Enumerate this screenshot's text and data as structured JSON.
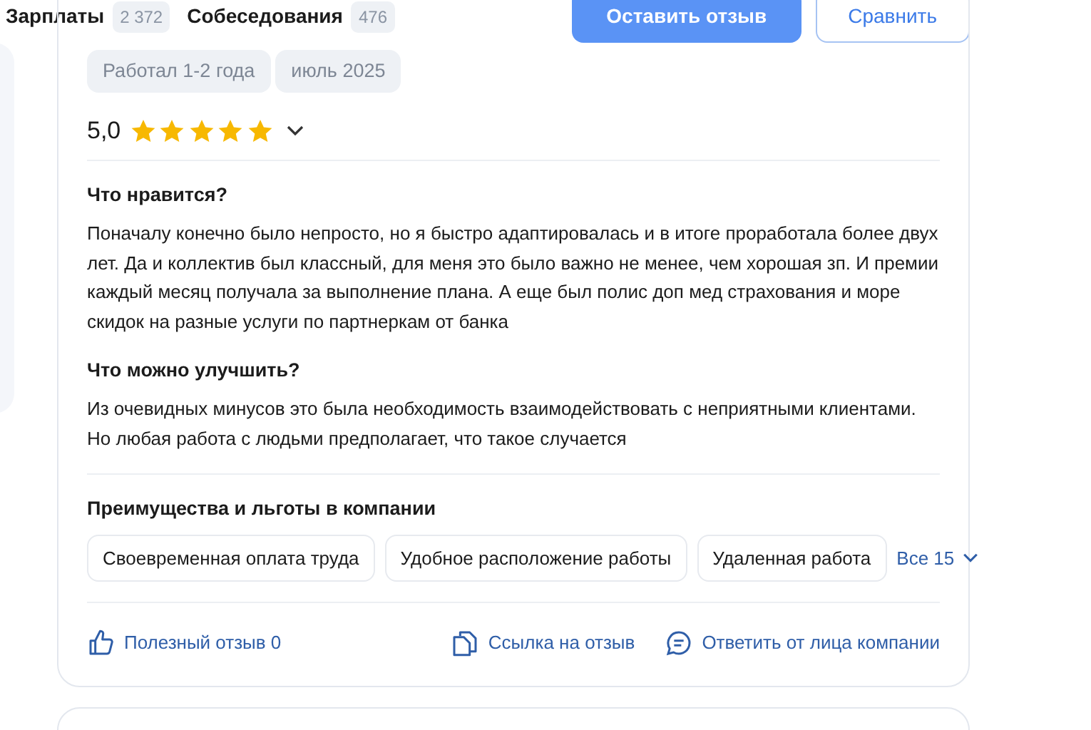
{
  "top_bar": {
    "tabs": [
      {
        "label": "Зарплаты",
        "count": "2 372"
      },
      {
        "label": "Собеседования",
        "count": "476"
      }
    ],
    "buttons": [
      {
        "label": "Оставить отзыв",
        "kind": "primary"
      },
      {
        "label": "Сравнить",
        "kind": "outline"
      }
    ]
  },
  "review": {
    "tags": [
      "Работал 1-2 года",
      "июль 2025"
    ],
    "rating": "5,0",
    "stars": 5,
    "sections": [
      {
        "title": "Что нравится?",
        "text": "Поначалу конечно было непросто, но я быстро адаптировалась и в итоге проработала более двух лет. Да и коллектив был классный, для меня это было важно не менее, чем хорошая зп. И премии каждый месяц получала за выполнение плана. А еще был полис доп мед страхования и море скидок на разные услуги по партнеркам от банка"
      },
      {
        "title": "Что можно улучшить?",
        "text": "Из очевидных минусов это была необходимость взаимодействовать с неприятными клиентами. Но любая работа с людьми предполагает, что такое случается"
      }
    ],
    "benefits": {
      "title": "Преимущества и льготы в компании",
      "items": [
        "Своевременная оплата труда",
        "Удобное расположение работы",
        "Удаленная работа"
      ],
      "more": "Все 15"
    },
    "actions": [
      {
        "label": "Полезный отзыв 0",
        "kind": "like"
      },
      {
        "label": "Ссылка на отзыв",
        "kind": "link"
      },
      {
        "label": "Ответить от лица компании",
        "kind": "reply"
      }
    ]
  }
}
